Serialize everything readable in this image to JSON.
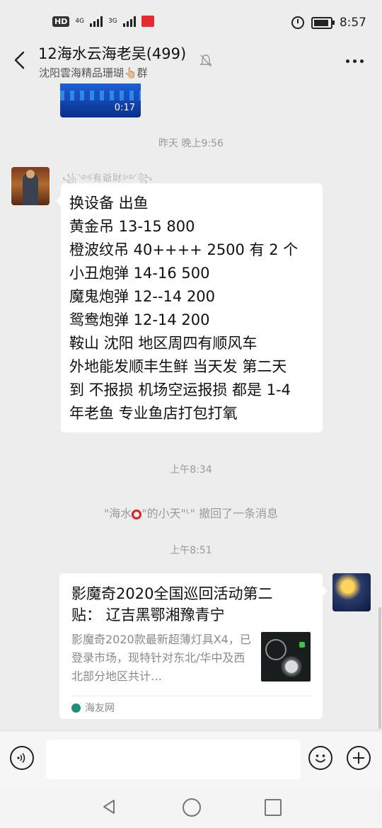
{
  "status_bar": {
    "left_badges": [
      "HD",
      "4G",
      "3G"
    ],
    "time": "8:57"
  },
  "header": {
    "title": "12海水云海老吴(499)",
    "subtitle": "沈阳雲海精品珊瑚👆🏼群"
  },
  "video": {
    "duration": "0:17"
  },
  "messages": {
    "time1": "昨天 晚上9:56",
    "nickname": "꧁༺有爺財༻꧂",
    "text_lines": [
      "换设备   出鱼",
      "黄金吊  13-15    800",
      "橙波纹吊  40++++   2500  有 2 个",
      "小丑炮弹   14-16   500",
      "魔鬼炮弹  12--14  200",
      "鸳鸯炮弹 12-14   200",
      "鞍山  沈阳  地区周四有顺风车",
      "外地能发顺丰生鲜  当天发  第二天",
      "到  不报损  机场空运报损  都是 1-4",
      "年老鱼  专业鱼店打包打氧"
    ],
    "time2": "上午8:34",
    "recall_prefix": "\"海水",
    "recall_suffix": "\"的小天\"ᴸ\" 撤回了一条消息",
    "time3": "上午8:51",
    "card": {
      "title": "影魔奇2020全国巡回活动第二贴：  辽吉黑鄂湘豫青宁",
      "description": "影魔奇2020款最新超薄灯具X4，已登录市场，现特针对东北/华中及西北部分地区共计…",
      "source": "海友网"
    }
  },
  "input_bar": {
    "text_value": ""
  }
}
